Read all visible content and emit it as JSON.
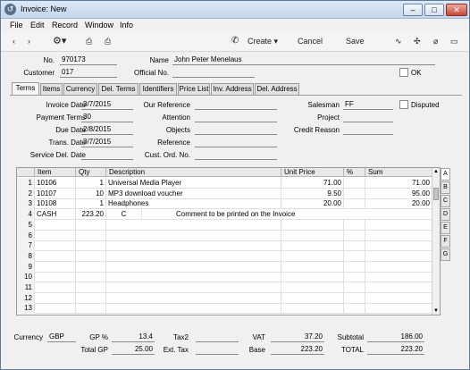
{
  "window": {
    "title": "Invoice: New"
  },
  "menu": [
    "File",
    "Edit",
    "Record",
    "Window",
    "Info"
  ],
  "toolbar": {
    "create": "Create",
    "cancel": "Cancel",
    "save": "Save"
  },
  "header": {
    "no_label": "No.",
    "no_value": "970173",
    "name_label": "Name",
    "name_value": "John Peter Menelaus",
    "customer_label": "Customer",
    "customer_value": "017",
    "official_label": "Official No.",
    "official_value": "",
    "ok_label": "OK"
  },
  "tabs": [
    "Terms",
    "Items",
    "Currency",
    "Del. Terms",
    "Identifiers",
    "Price List",
    "Inv. Address",
    "Del. Address"
  ],
  "terms": {
    "invoice_date_label": "Invoice Date",
    "invoice_date": "3/7/2015",
    "payment_terms_label": "Payment Terms",
    "payment_terms": "30",
    "due_date_label": "Due Date",
    "due_date": "2/8/2015",
    "trans_date_label": "Trans. Date",
    "trans_date": "3/7/2015",
    "service_del_label": "Service Del. Date",
    "service_del": "",
    "our_ref_label": "Our Reference",
    "our_ref": "",
    "attention_label": "Attention",
    "attention": "",
    "objects_label": "Objects",
    "objects": "",
    "reference_label": "Reference",
    "reference": "",
    "cust_ord_label": "Cust. Ord. No.",
    "cust_ord": "",
    "salesman_label": "Salesman",
    "salesman": "FF",
    "project_label": "Project",
    "project": "",
    "credit_reason_label": "Credit Reason",
    "credit_reason": "",
    "disputed_label": "Disputed"
  },
  "grid": {
    "headers": {
      "item": "Item",
      "qty": "Qty",
      "desc": "Description",
      "unit": "Unit Price",
      "pct": "%",
      "sum": "Sum"
    },
    "rows": [
      {
        "n": "1",
        "item": "10106",
        "qty": "1",
        "desc": "Universal Media Player",
        "unit": "71.00",
        "pct": "",
        "sum": "71.00"
      },
      {
        "n": "2",
        "item": "10107",
        "qty": "10",
        "desc": "MP3 download voucher",
        "unit": "9.50",
        "pct": "",
        "sum": "95.00"
      },
      {
        "n": "3",
        "item": "10108",
        "qty": "1",
        "desc": "Headphones",
        "unit": "20.00",
        "pct": "",
        "sum": "20.00"
      },
      {
        "n": "4",
        "item": "CASH",
        "qty": "223.20",
        "desc": "C",
        "unit": "Comment to be printed on the Invoice",
        "pct": "",
        "sum": ""
      },
      {
        "n": "5"
      },
      {
        "n": "6"
      },
      {
        "n": "7"
      },
      {
        "n": "8"
      },
      {
        "n": "9"
      },
      {
        "n": "10"
      },
      {
        "n": "11"
      },
      {
        "n": "12"
      },
      {
        "n": "13"
      }
    ],
    "side_tabs": [
      "A",
      "B",
      "C",
      "D",
      "E",
      "F",
      "G"
    ]
  },
  "footer": {
    "currency_label": "Currency",
    "currency": "GBP",
    "gp_pct_label": "GP %",
    "gp_pct": "13.4",
    "total_gp_label": "Total GP",
    "total_gp": "25.00",
    "tax2_label": "Tax2",
    "tax2": "",
    "ext_tax_label": "Ext. Tax",
    "ext_tax": "",
    "vat_label": "VAT",
    "vat": "37.20",
    "base_label": "Base",
    "base": "223.20",
    "subtotal_label": "Subtotal",
    "subtotal": "186.00",
    "total_label": "TOTAL",
    "total": "223.20"
  }
}
